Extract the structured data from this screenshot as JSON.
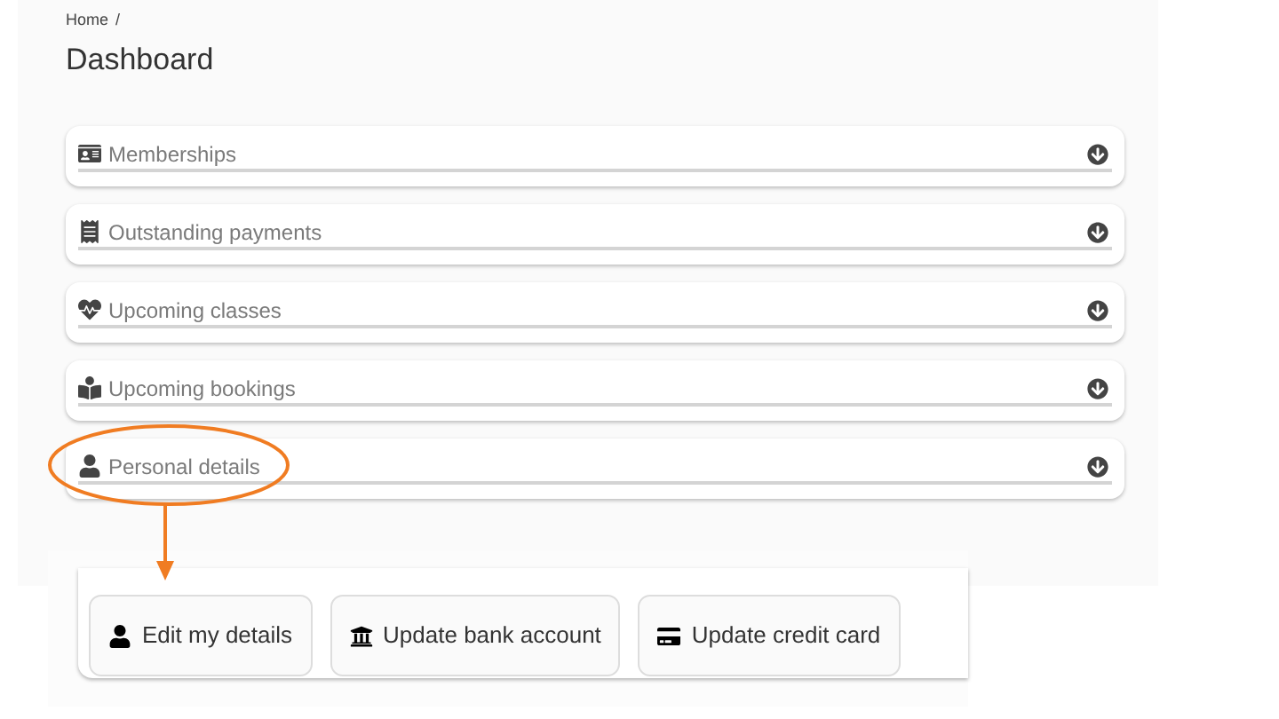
{
  "breadcrumb": {
    "items": [
      "Home"
    ],
    "separator": "/"
  },
  "title": "Dashboard",
  "sections": [
    {
      "label": "Memberships"
    },
    {
      "label": "Outstanding payments"
    },
    {
      "label": "Upcoming classes"
    },
    {
      "label": "Upcoming bookings"
    },
    {
      "label": "Personal details"
    }
  ],
  "actions": [
    {
      "label": "Edit my details"
    },
    {
      "label": "Update bank account"
    },
    {
      "label": "Update credit card"
    }
  ]
}
